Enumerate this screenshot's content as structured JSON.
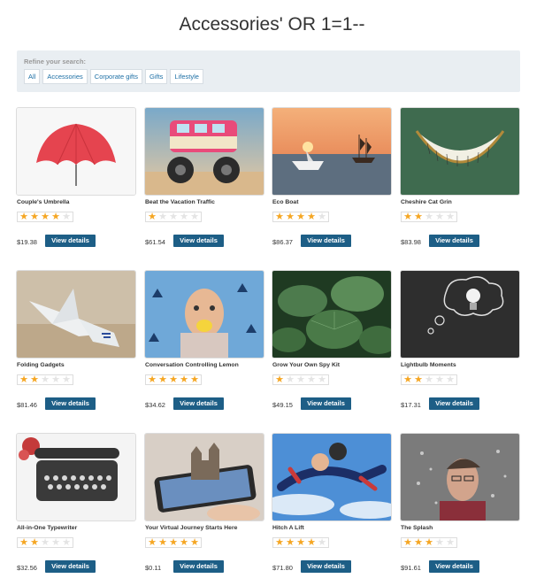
{
  "page": {
    "title": "Accessories' OR 1=1--"
  },
  "refine": {
    "label": "Refine your search:",
    "tags": [
      "All",
      "Accessories",
      "Corporate gifts",
      "Gifts",
      "Lifestyle"
    ]
  },
  "button_label": "View details",
  "products": [
    {
      "name": "Couple's Umbrella",
      "rating": 4,
      "price": "$19.38",
      "image": "umbrella"
    },
    {
      "name": "Beat the Vacation Traffic",
      "rating": 1,
      "price": "$61.54",
      "image": "monster-van"
    },
    {
      "name": "Eco Boat",
      "rating": 4,
      "price": "$86.37",
      "image": "paper-boat"
    },
    {
      "name": "Cheshire Cat Grin",
      "rating": 2,
      "price": "$83.98",
      "image": "grin"
    },
    {
      "name": "Folding Gadgets",
      "rating": 2,
      "price": "$81.46",
      "image": "origami"
    },
    {
      "name": "Conversation Controlling Lemon",
      "rating": 5,
      "price": "$34.62",
      "image": "lemon-man"
    },
    {
      "name": "Grow Your Own Spy Kit",
      "rating": 1,
      "price": "$49.15",
      "image": "leaves"
    },
    {
      "name": "Lightbulb Moments",
      "rating": 2,
      "price": "$17.31",
      "image": "lightbulb"
    },
    {
      "name": "All-in-One Typewriter",
      "rating": 2,
      "price": "$32.56",
      "image": "typewriter"
    },
    {
      "name": "Your Virtual Journey Starts Here",
      "rating": 5,
      "price": "$0.11",
      "image": "phone-castle"
    },
    {
      "name": "Hitch A Lift",
      "rating": 4,
      "price": "$71.80",
      "image": "skydivers"
    },
    {
      "name": "The Splash",
      "rating": 3,
      "price": "$91.61",
      "image": "splash"
    }
  ]
}
